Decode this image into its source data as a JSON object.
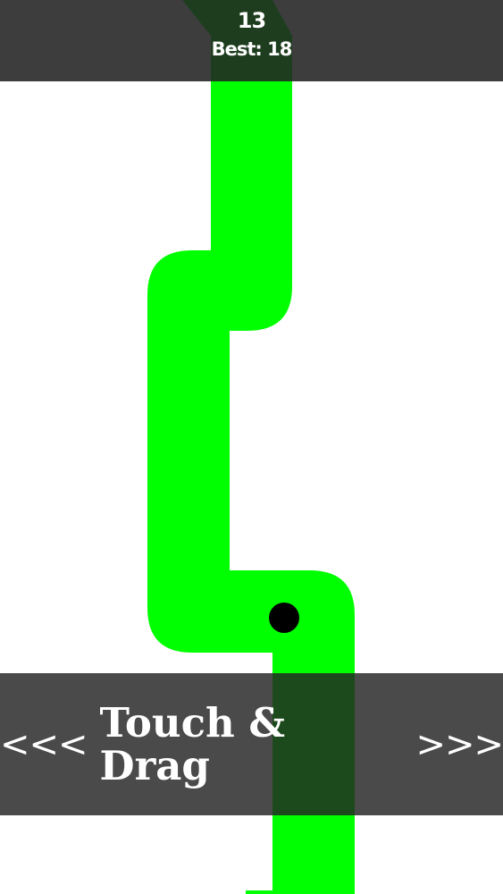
{
  "hud": {
    "score": "13",
    "best": "Best: 18"
  },
  "hint": {
    "left_arrows": "<<<",
    "text": "Touch & Drag",
    "right_arrows": ">>>"
  },
  "colors": {
    "path": "#00ff00",
    "background": "#ffffff",
    "ball": "#000000",
    "overlay": "#222222",
    "text": "#ffffff"
  }
}
